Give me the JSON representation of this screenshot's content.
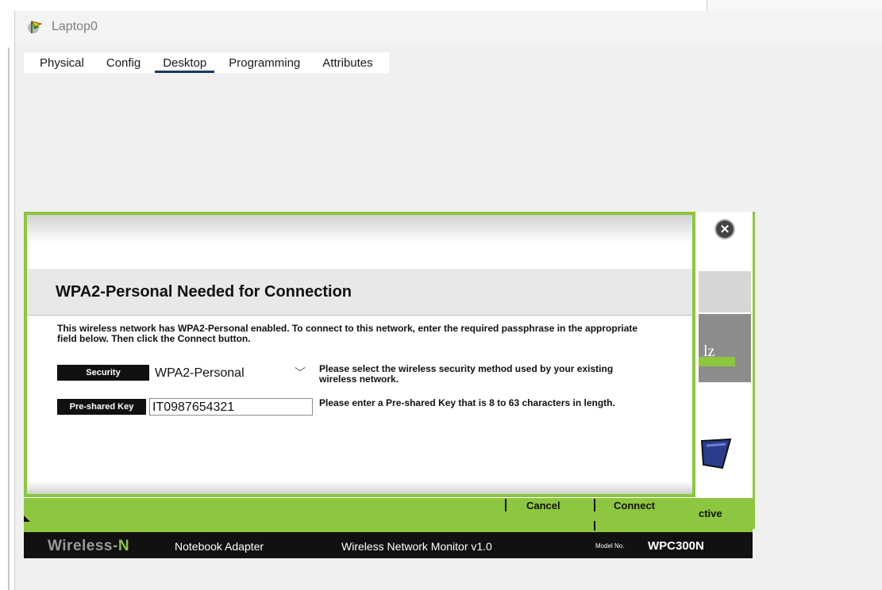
{
  "window": {
    "title": "Laptop0"
  },
  "tabs": [
    {
      "label": "Physical",
      "active": false
    },
    {
      "label": "Config",
      "active": false
    },
    {
      "label": "Desktop",
      "active": true
    },
    {
      "label": "Programming",
      "active": false
    },
    {
      "label": "Attributes",
      "active": false
    }
  ],
  "dialog": {
    "title": "WPA2-Personal Needed for Connection",
    "description_before": "This wireless network has WPA2-Personal enabled. To connect to this network, enter the required passphrase in the appropriate field below. Then click the ",
    "description_bold": "Connect",
    "description_after": " button.",
    "security": {
      "label": "Security",
      "value": "WPA2-Personal",
      "hint": "Please select the wireless security method used by your existing wireless network."
    },
    "psk": {
      "label": "Pre-shared Key",
      "value": "IT0987654321",
      "hint": "Please enter a Pre-shared Key that is 8 to 63 characters in length."
    },
    "cancel_label": "Cancel",
    "connect_label": "Connect"
  },
  "monitor": {
    "partial_text": "lz",
    "active_text": "ctive",
    "footer": {
      "logo_main": "Wireless-",
      "logo_n": "N",
      "product": "Notebook Adapter",
      "app_name": "Wireless Network Monitor  v1.0",
      "model_no_label": "Model No.",
      "model": "WPC300N"
    }
  },
  "colors": {
    "accent_green": "#8dc63f",
    "footer_black": "#111111",
    "tab_active_underline": "#1a3b5c"
  },
  "icons": {
    "app_icon": "laptop-app-icon",
    "close": "close-icon",
    "chevron": "chevron-down-icon"
  }
}
